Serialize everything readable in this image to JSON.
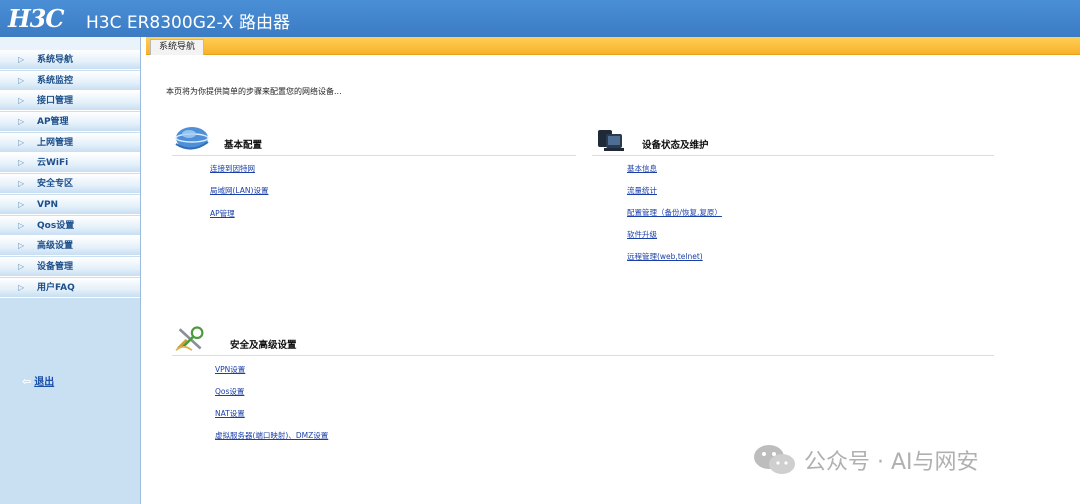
{
  "header": {
    "logo": "H3C",
    "title": "H3C ER8300G2-X 路由器"
  },
  "sidebar": {
    "items": [
      {
        "label": "系统导航"
      },
      {
        "label": "系统监控"
      },
      {
        "label": "接口管理"
      },
      {
        "label": "AP管理"
      },
      {
        "label": "上网管理"
      },
      {
        "label": "云WiFi"
      },
      {
        "label": "安全专区"
      },
      {
        "label": "VPN"
      },
      {
        "label": "Qos设置"
      },
      {
        "label": "高级设置"
      },
      {
        "label": "设备管理"
      },
      {
        "label": "用户FAQ"
      }
    ],
    "logout": "退出"
  },
  "tab": {
    "label": "系统导航"
  },
  "main": {
    "intro": "本页将为你提供简单的步骤来配置您的网络设备...",
    "basic": {
      "title": "基本配置",
      "links": [
        "连接到因特网",
        "局域网(LAN)设置",
        "AP管理"
      ]
    },
    "status": {
      "title": "设备状态及维护",
      "links": [
        "基本信息",
        "流量统计",
        "配置管理（备份/恢复,复原）",
        "软件升级",
        "远程管理(web,telnet)"
      ]
    },
    "security": {
      "title": "安全及高级设置",
      "links": [
        "VPN设置",
        "Qos设置",
        "NAT设置",
        "虚拟服务器(端口映射)、DMZ设置"
      ]
    }
  },
  "watermark": {
    "text": "公众号 · AI与网安"
  },
  "colors": {
    "header": "#3b7cc4",
    "tabbar": "#f7b22b",
    "sidebar": "#c9dff2",
    "link": "#1a3fa8"
  }
}
